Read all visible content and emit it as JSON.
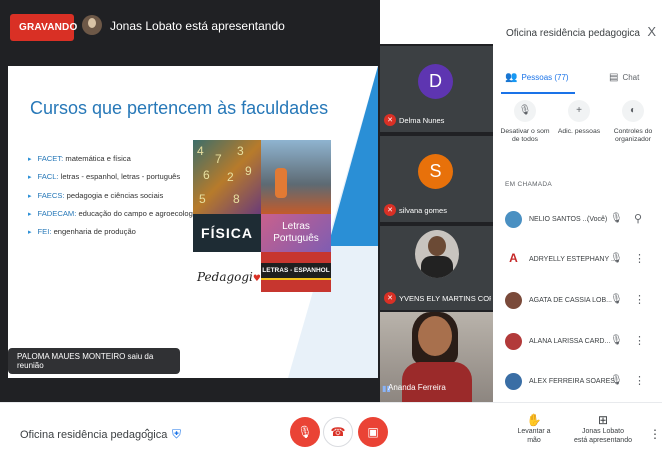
{
  "recording": {
    "label": "GRAVANDO"
  },
  "presenter": {
    "text": "Jonas Lobato está apresentando"
  },
  "slide": {
    "title": "Cursos que pertencem às faculdades",
    "bullets": [
      {
        "key": "FACET:",
        "text": " matemática e física"
      },
      {
        "key": "FACL:",
        "text": " letras - espanhol, letras - português"
      },
      {
        "key": "FAECS:",
        "text": " pedagogia e ciências sociais"
      },
      {
        "key": "FADECAM:",
        "text": " educação do campo e agroecologia"
      },
      {
        "key": "FEI:",
        "text": " engenharia de produção"
      }
    ],
    "collage": {
      "math_digits": [
        "4",
        "7",
        "3",
        "6",
        "2",
        "9",
        "5",
        "8"
      ],
      "fisica": "FÍSICA",
      "letras_line1": "Letras",
      "letras_line2": "Português",
      "pedagogia": "Pedagogi",
      "espanhol": "LETRAS - ESPANHOL"
    }
  },
  "toast": "PALOMA MAUES MONTEIRO saiu da reunião",
  "tiles": [
    {
      "initial": "D",
      "name": "Delma Nunes",
      "color": "#5e35b1"
    },
    {
      "initial": "S",
      "name": "silvana gomes",
      "color": "#e8710a"
    },
    {
      "initial": "",
      "name": "YVENS ELY MARTINS CORD...",
      "color": "#c8c4bf"
    },
    {
      "initial": "",
      "name": "Ananda Ferreira",
      "color": "#8d8680"
    }
  ],
  "panel": {
    "title": "Oficina residência pedagogica",
    "close": "X",
    "tab_people": "Pessoas (77)",
    "tab_chat": "Chat",
    "actions": [
      {
        "label": "Desativar o som de todos"
      },
      {
        "label": "Adic. pessoas"
      },
      {
        "label": "Controles do organizador"
      }
    ],
    "section": "EM CHAMADA",
    "people": [
      {
        "name": "NELIO SANTOS ...",
        "you": "(Você)",
        "avatar": "#4a90c2"
      },
      {
        "name": "ADRYELLY ESTEPHANY ...",
        "you": "",
        "avatar": "#c62828"
      },
      {
        "name": "AGATA DE CASSIA LOB...",
        "you": "",
        "avatar": "#7a4a3a"
      },
      {
        "name": "ALANA LARISSA CARD...",
        "you": "",
        "avatar": "#b23a3a"
      },
      {
        "name": "ALEX FERREIRA SOARES",
        "you": "",
        "avatar": "#3a6ea5"
      }
    ]
  },
  "bottom": {
    "meeting_name": "Oficina residência pedagogica",
    "raise_hand": "Levantar a mão",
    "presenting_line1": "Jonas Lobato",
    "presenting_line2": "está apresentando"
  }
}
